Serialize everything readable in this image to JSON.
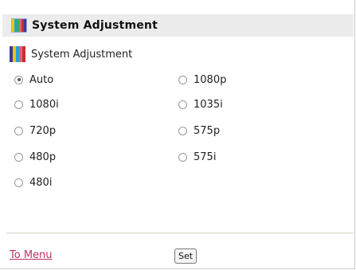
{
  "header": {
    "title": "System Adjustment",
    "icon": "color-bars-icon"
  },
  "section": {
    "title": "System Adjustment",
    "icon": "color-bars-icon"
  },
  "format_options": {
    "selected": "Auto",
    "items": [
      {
        "label": "Auto",
        "checked": true
      },
      {
        "label": "1080p",
        "checked": false
      },
      {
        "label": "1080i",
        "checked": false
      },
      {
        "label": "1035i",
        "checked": false
      },
      {
        "label": "720p",
        "checked": false
      },
      {
        "label": "575p",
        "checked": false
      },
      {
        "label": "480p",
        "checked": false
      },
      {
        "label": "575i",
        "checked": false
      },
      {
        "label": "480i",
        "checked": false
      }
    ]
  },
  "footer": {
    "menu_link": "To Menu",
    "set_button": "Set"
  },
  "colors": {
    "header_background": "#ececec",
    "link": "#c0306a",
    "divider": "#d8d8c8",
    "color_bars": [
      "#3a3a9a",
      "#e8c800",
      "#22a0d8",
      "#e06080",
      "#c83030",
      "#f0a020"
    ]
  }
}
